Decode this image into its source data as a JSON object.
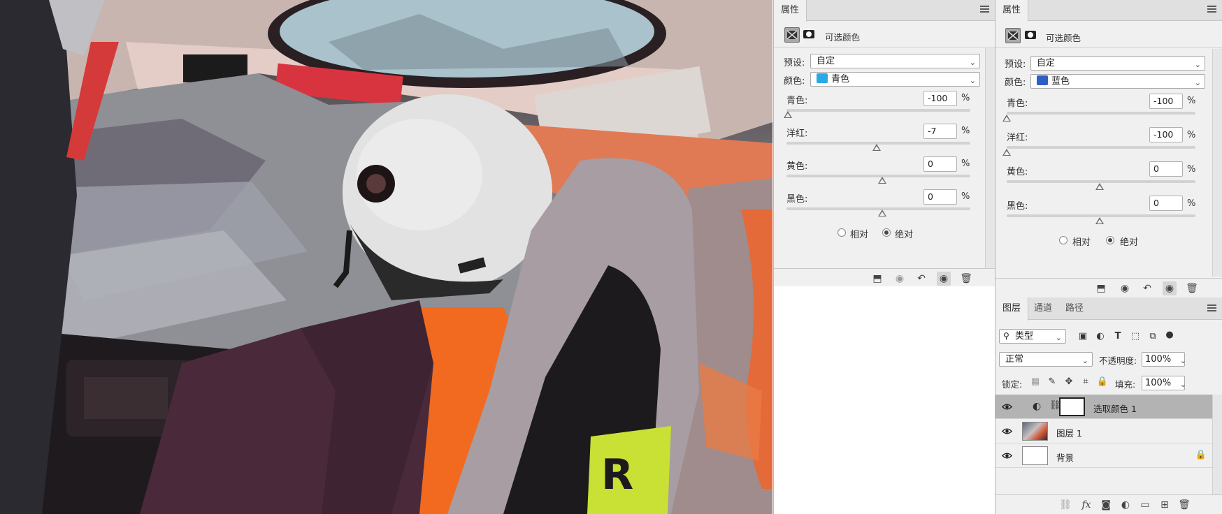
{
  "colors": {
    "panel_bg": "#f0f0f0",
    "cyan_swatch": "#29a9e8",
    "blue_swatch": "#2e5fc7",
    "selected_row": "#b3b3b3"
  },
  "props_left": {
    "tab": "属性",
    "mode_title": "可选颜色",
    "preset_label": "预设:",
    "preset_value": "自定",
    "color_label": "颜色:",
    "color_value": "青色",
    "sliders": [
      {
        "label": "青色:",
        "value": "-100",
        "unit": "%",
        "level": -100
      },
      {
        "label": "洋红:",
        "value": "-7",
        "unit": "%",
        "level": -7
      },
      {
        "label": "黄色:",
        "value": "0",
        "unit": "%",
        "level": 0
      },
      {
        "label": "黑色:",
        "value": "0",
        "unit": "%",
        "level": 0
      }
    ],
    "radio_relative": "相对",
    "radio_absolute": "绝对",
    "method": "绝对"
  },
  "props_right": {
    "tab": "属性",
    "mode_title": "可选颜色",
    "preset_label": "预设:",
    "preset_value": "自定",
    "color_label": "颜色:",
    "color_value": "蓝色",
    "sliders": [
      {
        "label": "青色:",
        "value": "-100",
        "unit": "%",
        "level": -100
      },
      {
        "label": "洋红:",
        "value": "-100",
        "unit": "%",
        "level": -100
      },
      {
        "label": "黄色:",
        "value": "0",
        "unit": "%",
        "level": 0
      },
      {
        "label": "黑色:",
        "value": "0",
        "unit": "%",
        "level": 0
      }
    ],
    "radio_relative": "相对",
    "radio_absolute": "绝对",
    "method": "绝对"
  },
  "layers_panel": {
    "tabs": [
      "图层",
      "通道",
      "路径"
    ],
    "filter_label": "类型",
    "blend_mode": "正常",
    "opacity_label": "不透明度:",
    "opacity_value": "100%",
    "lock_label": "锁定:",
    "fill_label": "填充:",
    "fill_value": "100%",
    "layers": [
      {
        "name": "选取颜色 1",
        "selected": true
      },
      {
        "name": "图层 1",
        "selected": false
      },
      {
        "name": "背景",
        "selected": false
      }
    ]
  }
}
